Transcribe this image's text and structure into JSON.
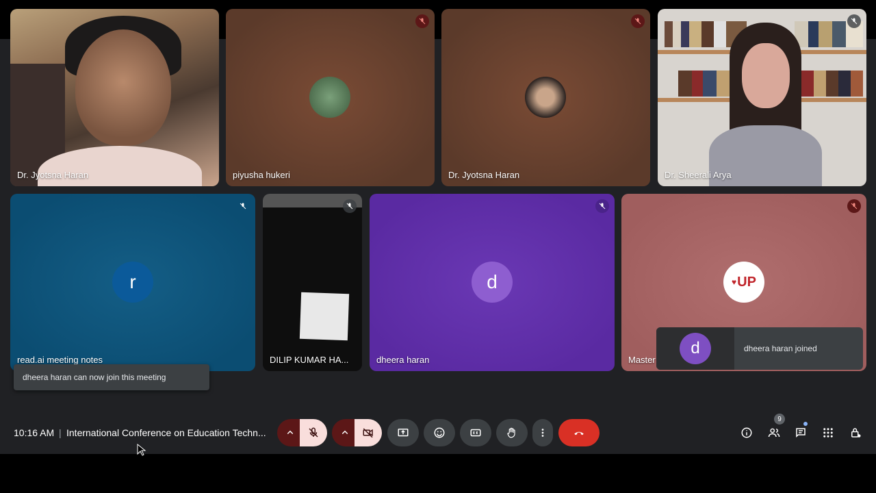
{
  "meeting": {
    "time": "10:16 AM",
    "separator": "|",
    "title": "International Conference on Education Techn...",
    "participant_count": "9"
  },
  "tiles": [
    {
      "name": "Dr. Jyotsna Haran",
      "muted": false
    },
    {
      "name": "piyusha hukeri",
      "muted": true
    },
    {
      "name": "Dr. Jyotsna Haran",
      "muted": true
    },
    {
      "name": "Dr. Sheerali Arya",
      "muted": true
    },
    {
      "name": "read.ai meeting notes",
      "avatar_letter": "r",
      "muted": true
    },
    {
      "name": "DILIP KUMAR HA...",
      "muted": true
    },
    {
      "name": "dheera haran",
      "avatar_letter": "d",
      "muted": true
    },
    {
      "name": "Master",
      "logo_text": "UP",
      "muted": true
    }
  ],
  "notifications": {
    "can_join": "dheera haran can now join this meeting",
    "joined": "dheera haran joined",
    "joined_avatar_letter": "d"
  },
  "colors": {
    "stage_bg": "#202124",
    "control_bg": "#3c4043",
    "end_call": "#d93025",
    "muted_bg": "#f9dedc",
    "caret_bg": "#5c1717",
    "accent_blue": "#8ab4f8"
  },
  "controls": {
    "mic": "mic-off-icon",
    "camera": "videocam-off-icon",
    "present": "present-screen-icon",
    "reactions": "emoji-icon",
    "captions": "captions-icon",
    "raise_hand": "hand-icon",
    "more": "more-vert-icon",
    "leave": "call-end-icon",
    "info": "info-icon",
    "people": "people-icon",
    "chat": "chat-icon",
    "activities": "apps-icon",
    "host_controls": "lock-person-icon"
  }
}
